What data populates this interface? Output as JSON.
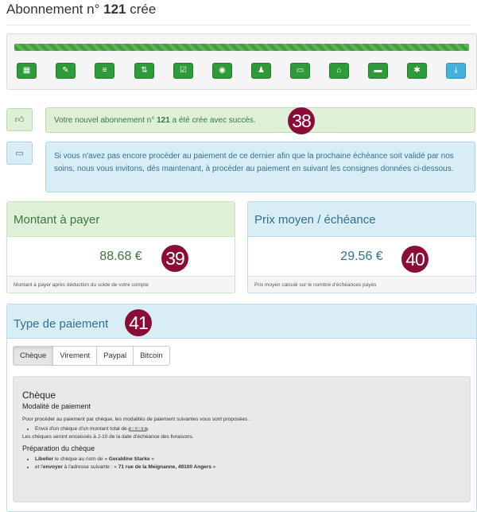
{
  "header": {
    "title_prefix": "Abonnement n°",
    "number": "121",
    "title_suffix": "crée"
  },
  "wizard": {
    "progress_percent": 100,
    "steps": [
      {
        "icon": "th-icon",
        "glyph": "▦"
      },
      {
        "icon": "wrench-icon",
        "glyph": "✎"
      },
      {
        "icon": "list-icon",
        "glyph": "≡"
      },
      {
        "icon": "sort-icon",
        "glyph": "⇅"
      },
      {
        "icon": "check-icon",
        "glyph": "☑"
      },
      {
        "icon": "eye-icon",
        "glyph": "◉"
      },
      {
        "icon": "user-icon",
        "glyph": "♟"
      },
      {
        "icon": "card-icon",
        "glyph": "▭"
      },
      {
        "icon": "home-icon",
        "glyph": "⌂"
      },
      {
        "icon": "comment-icon",
        "glyph": "▬"
      },
      {
        "icon": "asterisk-icon",
        "glyph": "✱"
      },
      {
        "icon": "download-check-icon",
        "glyph": "⤓",
        "active": true
      }
    ]
  },
  "alerts": {
    "success_prefix": "Votre nouvel abonnement n°",
    "success_number": "121",
    "success_suffix": "a été crée avec succès.",
    "info_text": "Si vous n'avez pas encore procéder au paiement de ce dernier afin que la prochaine échéance soit validé par nos soins, nous vous invitons, dès maintenant, à procéder au paiement en suivant les consignes données ci-dessous.",
    "success_icon": "thumbs-up-icon",
    "info_icon": "credit-card-icon"
  },
  "markers": [
    "38",
    "39",
    "40",
    "41"
  ],
  "cards": {
    "amount": {
      "title": "Montant à payer",
      "value": "88.68 €",
      "footer": "Montant à payer après déduction du solde de votre compte"
    },
    "average": {
      "title": "Prix moyen / échéance",
      "value": "29.56 €",
      "footer": "Prix moyen calculé sur le nombre d'échéances payés"
    }
  },
  "payment": {
    "title": "Type de paiement",
    "tabs": [
      "Chèque",
      "Virement",
      "Paypal",
      "Bitcoin"
    ],
    "active_tab": "Chèque",
    "cheque": {
      "heading": "Chèque",
      "subheading": "Modalité de paiement",
      "intro": "Pour procéder au paiement par chèque, les modalités de paiement suivantes vous sont proposées :",
      "bullet1_prefix": "Envoi d'un chèque d'un montant total de",
      "amount_badge": "88.68 €",
      "bullet1_suffix": ".",
      "delay_text": "Les chèques seront encaissés à J-10 de la date d'échéance des livraisons.",
      "prep_heading": "Préparation du chèque",
      "prep1_bold": "Libeller",
      "prep1_text": "le chèque au nom de «",
      "prep1_name": "Geraldine Starke",
      "prep1_end": "»",
      "prep2_prefix": "et l'",
      "prep2_bold": "envoyer",
      "prep2_text": "à l'adresse suivante : «",
      "prep2_address": "71 rue de la Meignanne, 49100 Angers",
      "prep2_end": "»"
    }
  },
  "colors": {
    "success": "#3c763d",
    "info": "#31708f",
    "step_green": "#2f9a3a",
    "step_active": "#46b0dc",
    "marker": "#8a0d38"
  }
}
